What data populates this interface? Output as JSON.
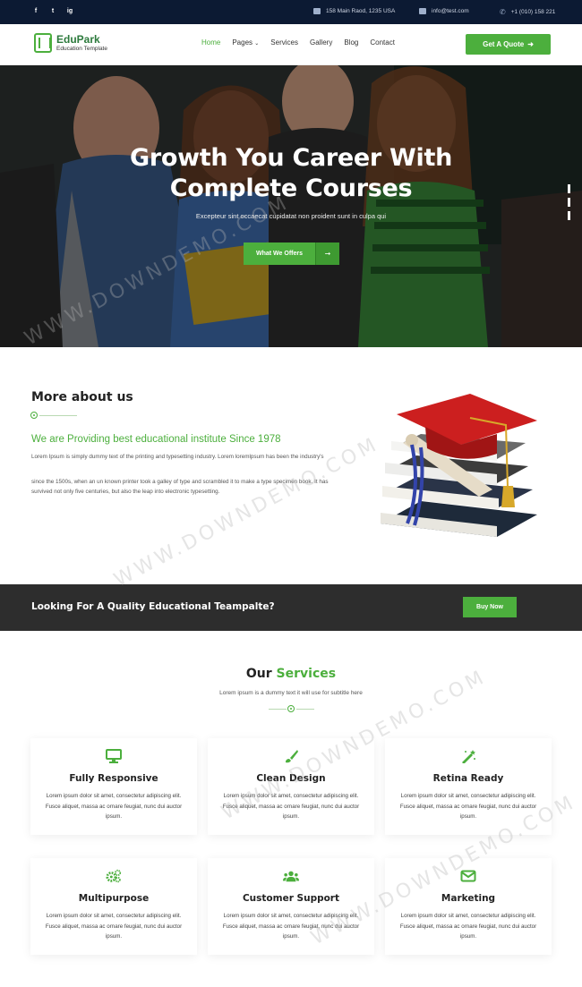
{
  "topbar": {
    "social": [
      "f",
      "t",
      "ig"
    ],
    "address": "158 Main Raod, 1235 USA",
    "email": "info@test.com",
    "phone": "+1 (010) 158 221"
  },
  "nav": {
    "brand": "EduPark",
    "tagline": "Education Template",
    "menu": [
      "Home",
      "Pages",
      "Services",
      "Gallery",
      "Blog",
      "Contact"
    ],
    "quote_button": "Get A Quote"
  },
  "hero": {
    "title_line1": "Growth You Career With",
    "title_line2": "Complete Courses",
    "subtitle": "Excepteur sint occaecat cupidatat non proident sunt in culpa qui",
    "cta": "What We Offers"
  },
  "about": {
    "title": "More about us",
    "subtitle": "We are Providing best educational institute Since 1978",
    "p1": "Lorem Ipsum is simply dummy text of the printing and typesetting industry. Lorem loremlpsum has been the industry's",
    "p2": "since the 1500s, when an un known printer took a galley of type and scrambled it to make a type specimen book. It has survived not only five centuries, but also the leap into electronic typesetting."
  },
  "cta_bar": {
    "text": "Looking For A Quality Educational Teampalte?",
    "button": "Buy Now"
  },
  "services": {
    "title_a": "Our",
    "title_b": "Services",
    "subtitle": "Lorem ipsum is a dummy text it will use for subtitle here",
    "items": [
      {
        "name": "Fully Responsive",
        "icon": "monitor-icon",
        "desc": "Lorem ipsum dolor sit amet, consectetur adipiscing elit. Fusce aliquet, massa ac ornare feugiat, nunc dui auctor ipsum."
      },
      {
        "name": "Clean Design",
        "icon": "paint-brush-icon",
        "desc": "Lorem ipsum dolor sit amet, consectetur adipiscing elit. Fusce aliquet, massa ac ornare feugiat, nunc dui auctor ipsum."
      },
      {
        "name": "Retina Ready",
        "icon": "magic-wand-icon",
        "desc": "Lorem ipsum dolor sit amet, consectetur adipiscing elit. Fusce aliquet, massa ac ornare feugiat, nunc dui auctor ipsum."
      },
      {
        "name": "Multipurpose",
        "icon": "cogs-icon",
        "desc": "Lorem ipsum dolor sit amet, consectetur adipiscing elit. Fusce aliquet, massa ac ornare feugiat, nunc dui auctor ipsum."
      },
      {
        "name": "Customer Support",
        "icon": "users-icon",
        "desc": "Lorem ipsum dolor sit amet, consectetur adipiscing elit. Fusce aliquet, massa ac ornare feugiat, nunc dui auctor ipsum."
      },
      {
        "name": "Marketing",
        "icon": "envelope-icon",
        "desc": "Lorem ipsum dolor sit amet, consectetur adipiscing elit. Fusce aliquet, massa ac ornare feugiat, nunc dui auctor ipsum."
      }
    ]
  },
  "watermark": "WWW.DOWNDEMO.COM",
  "colors": {
    "accent": "#4caf3d",
    "topbar": "#0c1a33",
    "dark": "#2d2d2d"
  }
}
